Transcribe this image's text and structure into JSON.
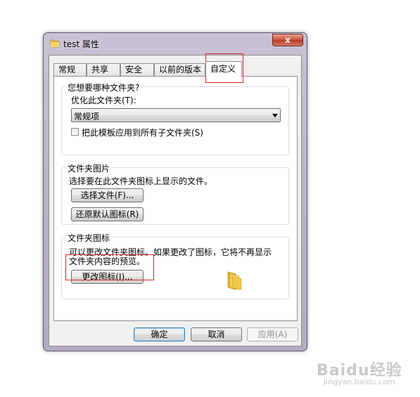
{
  "window": {
    "title": "test 属性",
    "close_symbol": "x"
  },
  "tabs": [
    {
      "label": "常规"
    },
    {
      "label": "共享"
    },
    {
      "label": "安全"
    },
    {
      "label": "以前的版本"
    },
    {
      "label": "自定义"
    }
  ],
  "group_folder_type": {
    "title": "您想要哪种文件夹?",
    "optimize_label": "优化此文件夹(T):",
    "select_value": "常规项",
    "checkbox_label": "把此模板应用到所有子文件夹(S)"
  },
  "group_folder_picture": {
    "title": "文件夹图片",
    "description": "选择要在此文件夹图标上显示的文件。",
    "choose_file_button": "选择文件(F)...",
    "restore_default_button": "还原默认图标(R)"
  },
  "group_folder_icon": {
    "title": "文件夹图标",
    "description_line1": "可以更改文件夹图标。如果更改了图标，它将不再显示",
    "description_line2": "文件夹内容的预览。",
    "change_icon_button": "更改图标(I)..."
  },
  "footer": {
    "ok_button": "确定",
    "cancel_button": "取消",
    "apply_button": "应用(A)"
  },
  "watermark": {
    "text": "Baidu经验",
    "sub": "jingyan.baidu.com"
  },
  "colors": {
    "highlight": "#e0262b",
    "folder": "#f2c94c"
  }
}
